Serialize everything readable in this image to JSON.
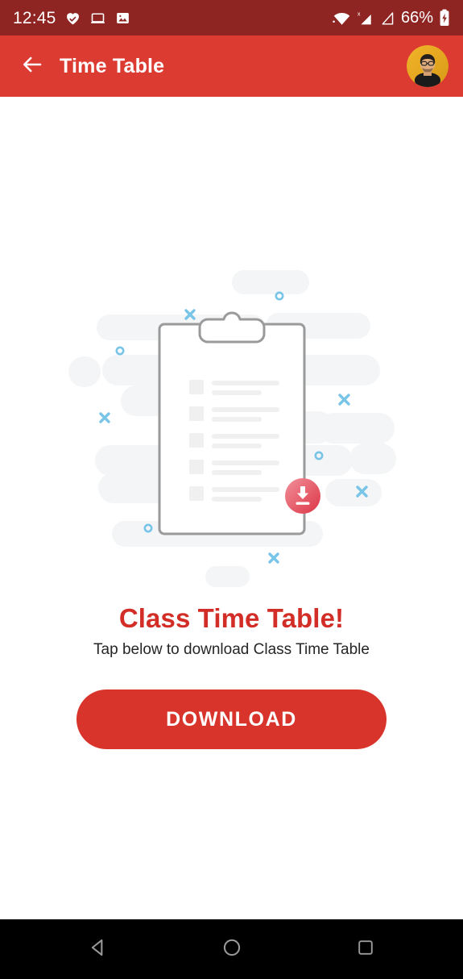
{
  "status_bar": {
    "time": "12:45",
    "battery_percent": "66%",
    "background_color": "#8E2522",
    "icons": [
      {
        "name": "heart-check-icon"
      },
      {
        "name": "laptop-icon"
      },
      {
        "name": "image-icon"
      },
      {
        "name": "wifi-icon"
      },
      {
        "name": "cellular-no-sim-icon"
      },
      {
        "name": "cellular-signal-icon"
      },
      {
        "name": "battery-charging-icon"
      }
    ]
  },
  "app_bar": {
    "title": "Time Table",
    "back_icon": "arrow-left-icon",
    "avatar_icon": "user-avatar",
    "background_color": "#DC3B32",
    "title_color": "#FFFFFF"
  },
  "main": {
    "headline": "Class Time Table!",
    "headline_color": "#D32D27",
    "subtext": "Tap below to download Class Time Table",
    "subtext_color": "#262626",
    "download_button_label": "DOWNLOAD",
    "download_button_color": "#D8342B",
    "illustration": {
      "name": "clipboard-download-illustration",
      "clipboard_outline_color": "#9A9A9A",
      "badge_icon": "download-arrow-icon",
      "badge_color_from": "#F08A96",
      "badge_color_to": "#DC3545",
      "accent_color": "#79C5E8",
      "cloud_color": "#F4F5F6",
      "row_count": 5
    }
  },
  "nav_bar": {
    "background_color": "#000000",
    "buttons": [
      {
        "name": "nav-back-button",
        "icon": "triangle-left-icon"
      },
      {
        "name": "nav-home-button",
        "icon": "circle-icon"
      },
      {
        "name": "nav-recents-button",
        "icon": "square-icon"
      }
    ]
  }
}
